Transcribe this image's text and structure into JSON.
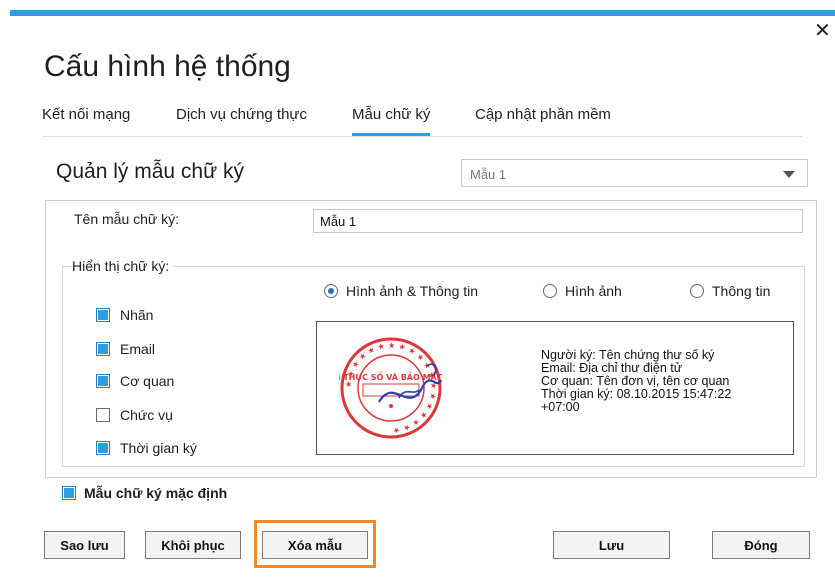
{
  "window": {
    "title": "Cấu hình hệ thống",
    "close_label": "✕"
  },
  "tabs": [
    {
      "label": "Kết nối mạng",
      "active": false
    },
    {
      "label": "Dịch vụ chứng thực",
      "active": false
    },
    {
      "label": "Mẫu chữ ký",
      "active": true
    },
    {
      "label": "Cập nhật phần mềm",
      "active": false
    }
  ],
  "manager": {
    "title": "Quản lý mẫu chữ ký",
    "selected_template": "Mẫu 1"
  },
  "form": {
    "name_label": "Tên mẫu chữ ký:",
    "name_value": "Mẫu 1",
    "display_label": "Hiển thị chữ ký:"
  },
  "checkboxes": [
    {
      "label": "Nhãn",
      "checked": true
    },
    {
      "label": "Email",
      "checked": true
    },
    {
      "label": "Cơ quan",
      "checked": true
    },
    {
      "label": "Chức vụ",
      "checked": false
    },
    {
      "label": "Thời gian ký",
      "checked": true
    }
  ],
  "radios": [
    {
      "label": "Hình ảnh & Thông tin",
      "checked": true
    },
    {
      "label": "Hình ảnh",
      "checked": false
    },
    {
      "label": "Thông tin",
      "checked": false
    }
  ],
  "preview": {
    "stamp_text": "CỤC CHỨNG THỰC SỐ VÀ BẢO MẬT THÔNG TIN",
    "lines": [
      "Người ký: Tên chứng thư số ký",
      "Email: Địa chỉ thư điện tử",
      "Cơ quan: Tên đơn vị, tên cơ quan",
      "Thời gian ký: 08.10.2015 15:47:22",
      "+07:00"
    ]
  },
  "default_template": {
    "label": "Mẫu chữ ký mặc định",
    "checked": true
  },
  "buttons": {
    "backup": "Sao lưu",
    "restore": "Khôi phục",
    "delete": "Xóa mẫu",
    "save": "Lưu",
    "close": "Đóng"
  },
  "colors": {
    "accent": "#2a9fe0",
    "highlight": "#f0882a",
    "stamp": "#d83a3a",
    "signature": "#2a3fb0"
  }
}
